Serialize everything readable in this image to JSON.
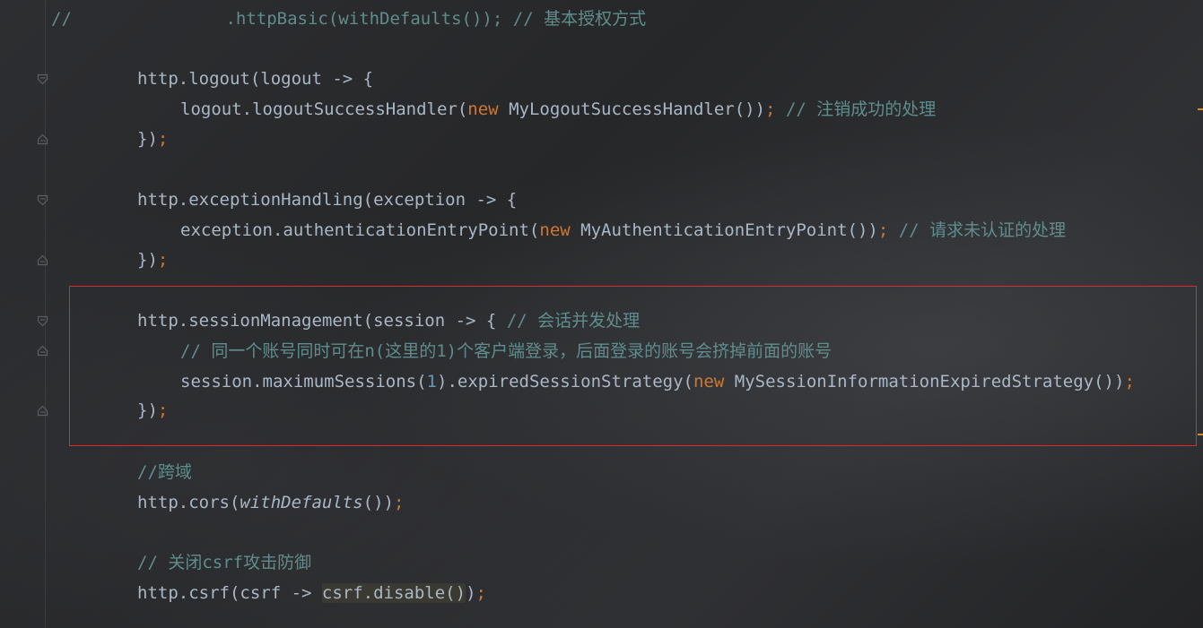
{
  "editor": {
    "lines": [
      {
        "id": "l1",
        "parts": [
          {
            "t": "//               .httpBasic(withDefaults()); // 基本授权方式",
            "c": "comment"
          }
        ]
      },
      {
        "id": "l2",
        "parts": [
          {
            "t": "http.logout(logout -> {",
            "c": "plain"
          }
        ]
      },
      {
        "id": "l3",
        "parts": [
          {
            "t": "logout.logoutSuccessHandler(",
            "c": "plain"
          },
          {
            "t": "new",
            "c": "kw"
          },
          {
            "t": " MyLogoutSuccessHandler())",
            "c": "plain"
          },
          {
            "t": ";",
            "c": "kw"
          },
          {
            "t": " // 注销成功的处理",
            "c": "comment"
          }
        ]
      },
      {
        "id": "l4",
        "parts": [
          {
            "t": "})",
            "c": "plain"
          },
          {
            "t": ";",
            "c": "kw"
          }
        ]
      },
      {
        "id": "l5",
        "parts": [
          {
            "t": "http.exceptionHandling(exception -> {",
            "c": "plain"
          }
        ]
      },
      {
        "id": "l6",
        "parts": [
          {
            "t": "exception.authenticationEntryPoint(",
            "c": "plain"
          },
          {
            "t": "new",
            "c": "kw"
          },
          {
            "t": " MyAuthenticationEntryPoint())",
            "c": "plain"
          },
          {
            "t": ";",
            "c": "kw"
          },
          {
            "t": " // 请求未认证的处理",
            "c": "comment"
          }
        ]
      },
      {
        "id": "l7",
        "parts": [
          {
            "t": "})",
            "c": "plain"
          },
          {
            "t": ";",
            "c": "kw"
          }
        ]
      },
      {
        "id": "l8",
        "parts": [
          {
            "t": "http.sessionManagement(session -> { ",
            "c": "plain"
          },
          {
            "t": "// 会话并发处理",
            "c": "comment"
          }
        ]
      },
      {
        "id": "l9",
        "parts": [
          {
            "t": "// 同一个账号同时可在n(这里的1)个客户端登录，后面登录的账号会挤掉前面的账号",
            "c": "comment"
          }
        ]
      },
      {
        "id": "l10",
        "parts": [
          {
            "t": "session.maximumSessions(",
            "c": "plain"
          },
          {
            "t": "1",
            "c": "num"
          },
          {
            "t": ").expiredSessionStrategy(",
            "c": "plain"
          },
          {
            "t": "new",
            "c": "kw"
          },
          {
            "t": " MySessionInformationExpiredStrategy())",
            "c": "plain"
          },
          {
            "t": ";",
            "c": "kw"
          }
        ]
      },
      {
        "id": "l11",
        "parts": [
          {
            "t": "})",
            "c": "plain"
          },
          {
            "t": ";",
            "c": "kw"
          }
        ]
      },
      {
        "id": "l12",
        "parts": [
          {
            "t": "//跨域",
            "c": "comment"
          }
        ]
      },
      {
        "id": "l13",
        "parts": [
          {
            "t": "http.cors(",
            "c": "plain"
          },
          {
            "t": "withDefaults",
            "c": "plain ital"
          },
          {
            "t": "())",
            "c": "plain"
          },
          {
            "t": ";",
            "c": "kw"
          }
        ]
      },
      {
        "id": "l14",
        "parts": [
          {
            "t": "// 关闭csrf攻击防御",
            "c": "comment"
          }
        ]
      },
      {
        "id": "l15",
        "parts": [
          {
            "t": "http.csrf(csrf -> ",
            "c": "plain"
          },
          {
            "t": "csrf.disable()",
            "c": "plain hl"
          },
          {
            "t": ")",
            "c": "plain"
          },
          {
            "t": ";",
            "c": "kw"
          }
        ]
      }
    ]
  },
  "colors": {
    "keyword": "#cc7832",
    "number": "#6897bb",
    "comment": "#5f8d8d",
    "text": "#a9b7c6",
    "selection_border": "#e0282d"
  },
  "icons": [
    "fold-open-icon",
    "fold-close-icon"
  ]
}
